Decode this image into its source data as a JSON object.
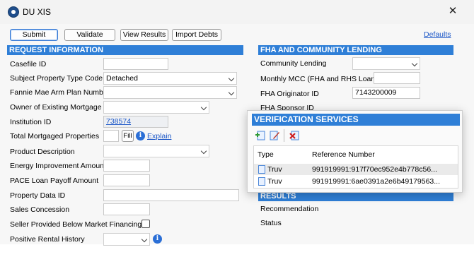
{
  "window": {
    "title": "DU XIS",
    "close_glyph": "✕"
  },
  "toolbar": {
    "submit": "Submit",
    "validate": "Validate",
    "view_results": "View Results",
    "import_debts": "Import Debts",
    "defaults": "Defaults"
  },
  "request": {
    "header": "REQUEST INFORMATION",
    "casefile_id": {
      "label": "Casefile ID",
      "value": ""
    },
    "subject_property_type": {
      "label": "Subject Property Type Code",
      "value": "Detached"
    },
    "fannie_mae_arm": {
      "label": "Fannie Mae Arm Plan Number",
      "value": ""
    },
    "owner_existing_mortgage": {
      "label": "Owner of Existing Mortgage",
      "value": ""
    },
    "institution_id": {
      "label": "Institution ID",
      "value": "738574"
    },
    "total_mortgaged": {
      "label": "Total Mortgaged Properties",
      "value": "",
      "fill": "Fill",
      "explain": "Explain"
    },
    "product_description": {
      "label": "Product Description",
      "value": ""
    },
    "energy_improvement": {
      "label": "Energy Improvement Amount",
      "value": ""
    },
    "pace_loan_payoff": {
      "label": "PACE Loan Payoff Amount",
      "value": ""
    },
    "property_data_id": {
      "label": "Property Data ID",
      "value": ""
    },
    "sales_concession": {
      "label": "Sales Concession",
      "value": ""
    },
    "seller_below_market": {
      "label": "Seller Provided Below Market Financing",
      "checked": false
    },
    "positive_rental_history": {
      "label": "Positive Rental History",
      "value": ""
    }
  },
  "fha": {
    "header": "FHA AND COMMUNITY LENDING",
    "community_lending": {
      "label": "Community Lending",
      "value": ""
    },
    "monthly_mcc": {
      "label": "Monthly MCC (FHA and RHS Loans)",
      "value": ""
    },
    "originator_id": {
      "label": "FHA Originator ID",
      "value": "7143200009"
    },
    "sponsor_id": {
      "label": "FHA Sponsor ID"
    }
  },
  "results": {
    "header": "RESULTS",
    "recommendation": "Recommendation",
    "status": "Status"
  },
  "verification": {
    "header": "VERIFICATION SERVICES",
    "columns": [
      "Type",
      "Reference Number"
    ],
    "rows": [
      {
        "type": "Truv",
        "reference": "991919991:917f70ec952e4b778c56...",
        "selected": true
      },
      {
        "type": "Truv",
        "reference": "991919991:6ae0391a2e6b49179563...",
        "selected": false
      }
    ],
    "toolbar_icons": [
      "add-icon",
      "edit-icon",
      "delete-icon"
    ]
  },
  "info_glyph": "i"
}
